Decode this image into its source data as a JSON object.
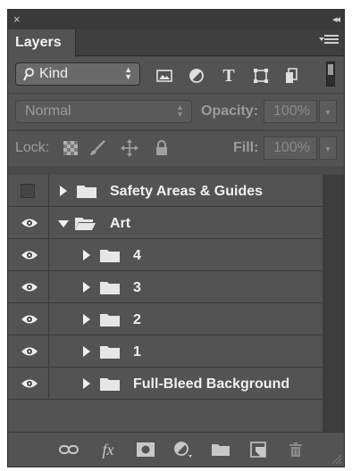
{
  "window": {
    "close_glyph": "×",
    "collapse_glyph": "◂◂"
  },
  "panel": {
    "tab_label": "Layers"
  },
  "filter": {
    "kind_label": "Kind",
    "icons": [
      "search-icon",
      "pixel-layer-filter-icon",
      "adjustment-layer-filter-icon",
      "type-layer-filter-icon",
      "shape-layer-filter-icon",
      "smart-object-filter-icon"
    ]
  },
  "blend": {
    "mode": "Normal",
    "opacity_label": "Opacity:",
    "opacity_value": "100%"
  },
  "lock": {
    "lock_label": "Lock:",
    "fill_label": "Fill:",
    "fill_value": "100%"
  },
  "layers": [
    {
      "name": "Safety Areas & Guides",
      "visible": false,
      "expanded": false
    },
    {
      "name": "Art",
      "visible": true,
      "expanded": true
    },
    {
      "name": "4",
      "visible": true,
      "expanded": false
    },
    {
      "name": "3",
      "visible": true,
      "expanded": false
    },
    {
      "name": "2",
      "visible": true,
      "expanded": false
    },
    {
      "name": "1",
      "visible": true,
      "expanded": false
    },
    {
      "name": "Full-Bleed Background",
      "visible": true,
      "expanded": false
    }
  ],
  "bottom_bar": {
    "fx_label": "fx",
    "icons": [
      "link-layers-icon",
      "layer-style-icon",
      "add-mask-icon",
      "new-adjustment-layer-icon",
      "new-group-icon",
      "new-layer-icon",
      "delete-layer-icon"
    ]
  },
  "colors": {
    "panel_bg": "#535353",
    "dark_bg": "#3d3d3d",
    "text": "#f0f0f0",
    "dim_text": "#9c9c9c"
  }
}
